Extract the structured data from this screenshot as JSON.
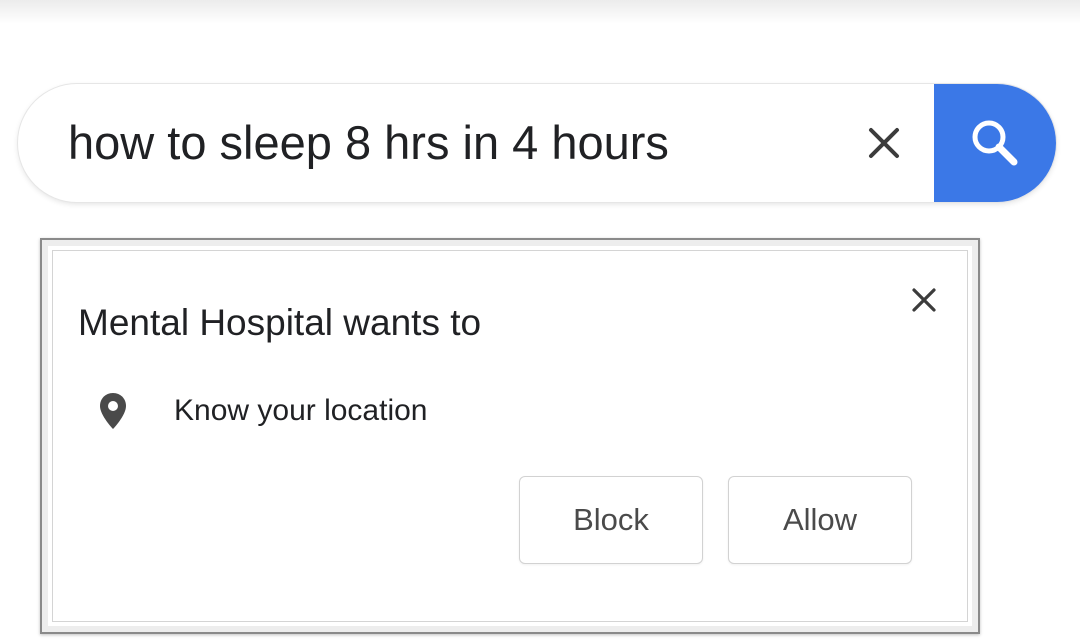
{
  "colors": {
    "search_button": "#3b78e7",
    "text": "#202124",
    "button_text": "#4a4a4a"
  },
  "search": {
    "query": "how to sleep 8 hrs in 4 hours",
    "clear_icon": "close-icon",
    "search_icon": "magnifier-icon"
  },
  "permission_prompt": {
    "title": "Mental Hospital wants to",
    "close_icon": "close-icon",
    "permission": {
      "icon": "location-pin-icon",
      "label": "Know your location"
    },
    "buttons": {
      "block": "Block",
      "allow": "Allow"
    }
  }
}
